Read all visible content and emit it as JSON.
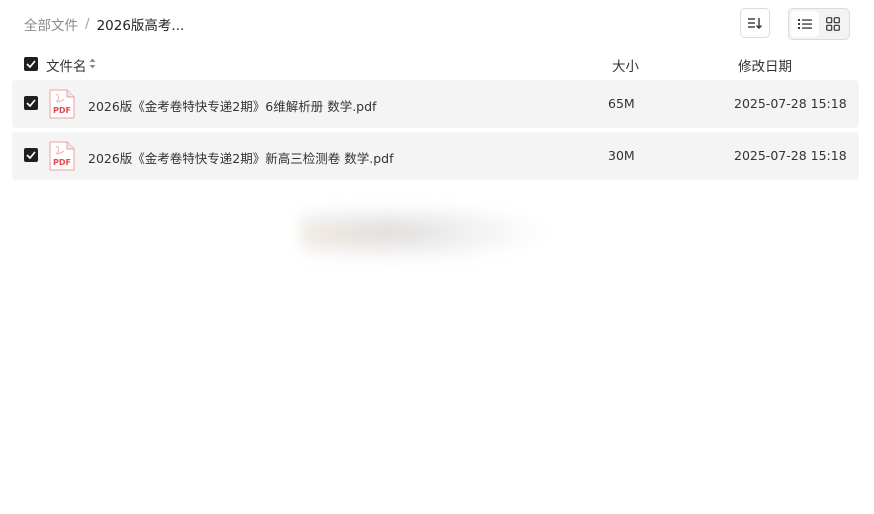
{
  "breadcrumb": {
    "root": "全部文件",
    "separator": "/",
    "current": "2026版高考..."
  },
  "toolbar": {
    "sort_icon": "sort-icon",
    "view_list_icon": "list-view-icon",
    "view_grid_icon": "grid-view-icon",
    "active_view": "list"
  },
  "table": {
    "columns": {
      "name": "文件名",
      "size": "大小",
      "date": "修改日期"
    },
    "rows": [
      {
        "icon_label": "PDF",
        "name": "2026版《金考卷特快专递2期》6维解析册 数学.pdf",
        "size": "65M",
        "date": "2025-07-28 15:18",
        "checked": true
      },
      {
        "icon_label": "PDF",
        "name": "2026版《金考卷特快专递2期》新高三检测卷 数学.pdf",
        "size": "30M",
        "date": "2025-07-28 15:18",
        "checked": true
      }
    ]
  },
  "colors": {
    "row_bg": "#f4f4f4",
    "checkbox": "#1f1f1f",
    "pdf_red": "#e5484d"
  }
}
